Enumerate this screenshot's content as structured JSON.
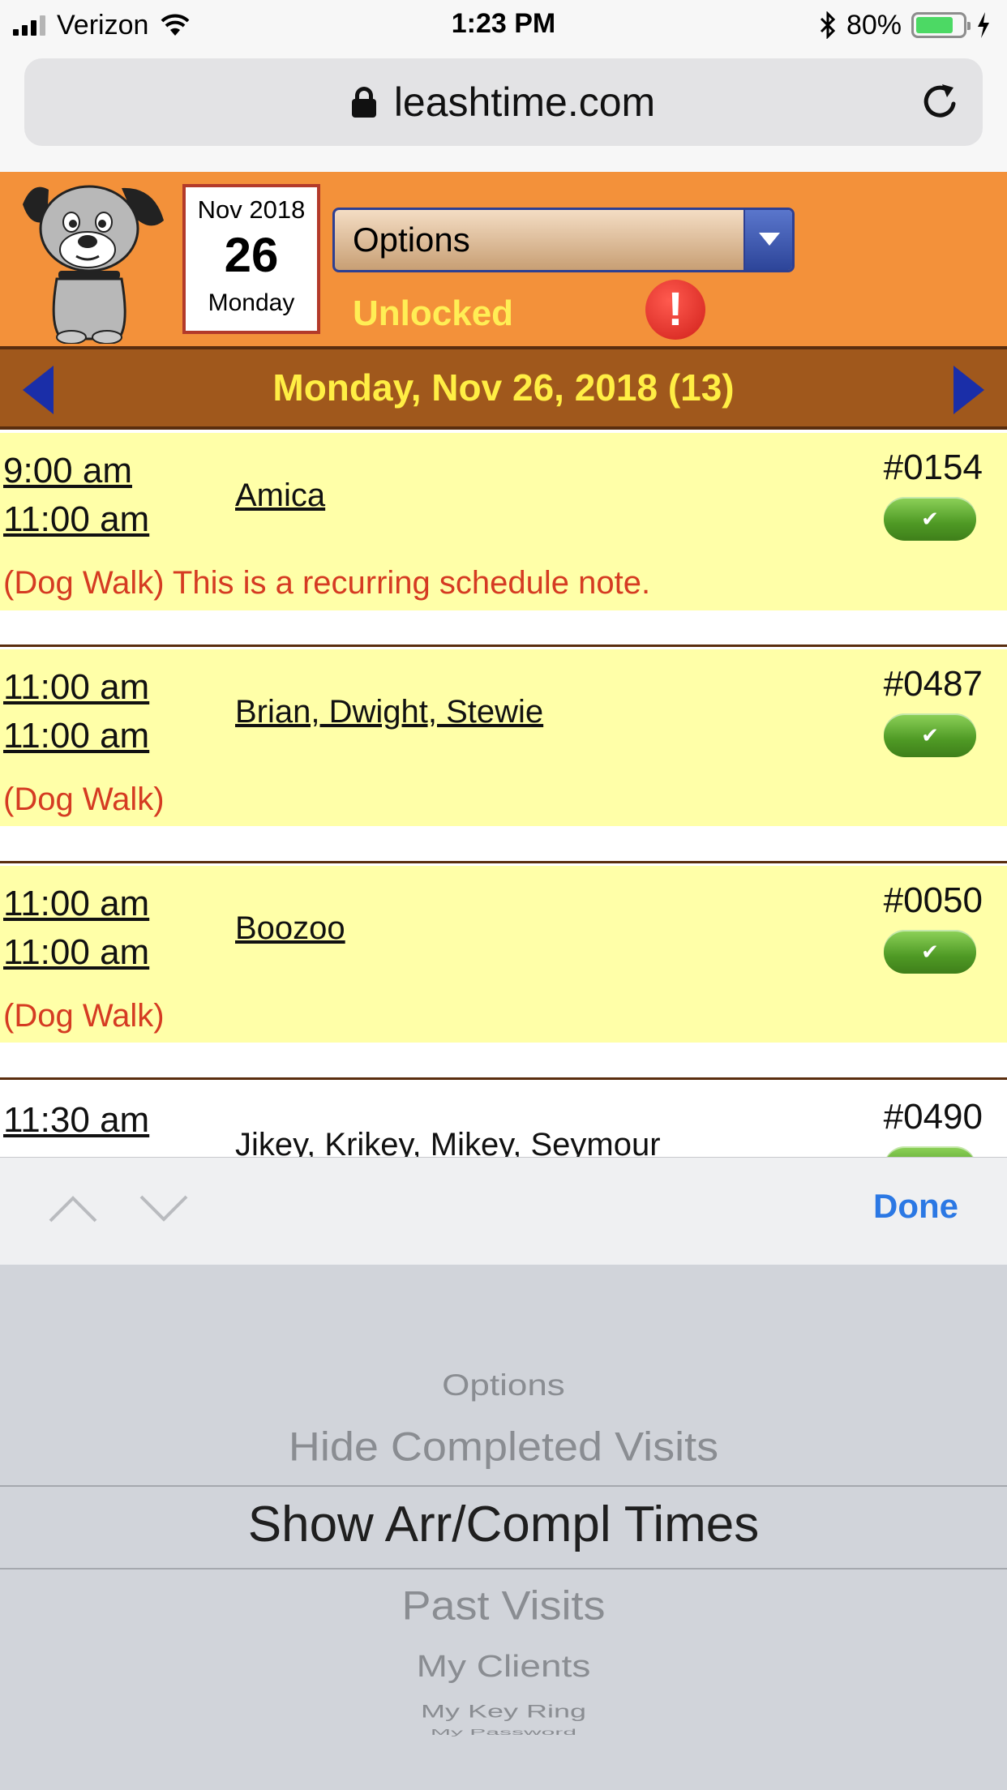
{
  "status_bar": {
    "carrier": "Verizon",
    "time": "1:23 PM",
    "battery": "80%",
    "battery_level": 0.8
  },
  "browser": {
    "url": "leashtime.com"
  },
  "header": {
    "date_card": {
      "month_year": "Nov 2018",
      "day": "26",
      "weekday": "Monday"
    },
    "options_label": "Options",
    "lock_status": "Unlocked",
    "alert_symbol": "!"
  },
  "date_nav": {
    "title": "Monday, Nov 26, 2018 (13)"
  },
  "visits": [
    {
      "start": "9:00 am",
      "end": "11:00 am",
      "client": "Amica",
      "number": "#0154",
      "note": "(Dog Walk) This is a recurring schedule note."
    },
    {
      "start": "11:00 am",
      "end": "11:00 am",
      "client": "Brian, Dwight, Stewie",
      "number": "#0487",
      "note": "(Dog Walk)"
    },
    {
      "start": "11:00 am",
      "end": "11:00 am",
      "client": "Boozoo",
      "number": "#0050",
      "note": "(Dog Walk)"
    },
    {
      "start": "11:30 am",
      "end": "",
      "client": "Jikey, Krikey, Mikey, Seymour",
      "number": "#0490",
      "note": ""
    }
  ],
  "picker": {
    "done_label": "Done",
    "options": [
      "Options",
      "Hide Completed Visits",
      "Show Arr/Compl Times",
      "Past Visits",
      "My Clients",
      "My Key Ring",
      "My Password"
    ],
    "selected_index": 2
  },
  "colors": {
    "header_orange": "#f3913a",
    "nav_brown": "#a0581c",
    "visit_yellow": "#ffffa8",
    "note_red": "#d53b22",
    "accent_blue": "#2b78e4"
  }
}
